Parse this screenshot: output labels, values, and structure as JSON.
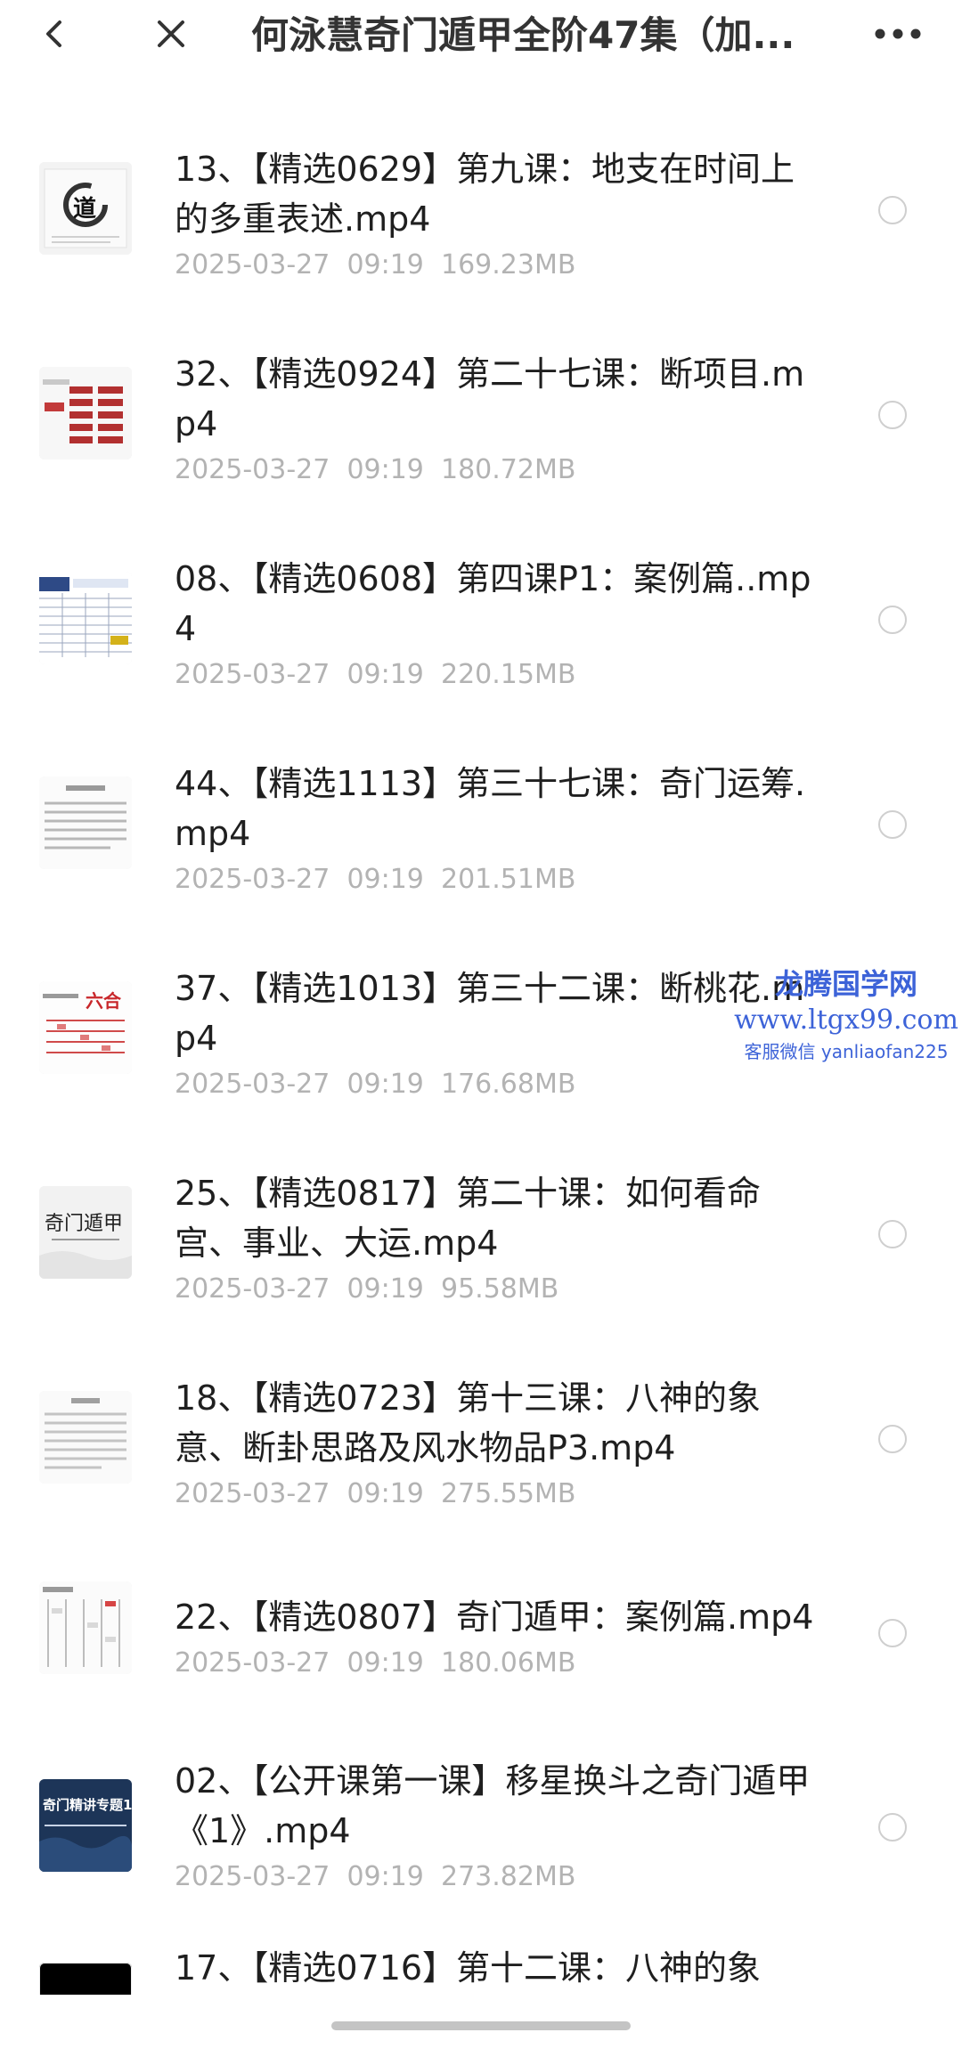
{
  "header": {
    "title": "何泳慧奇门遁甲全阶47集（加...",
    "back_icon": "chevron-left-icon",
    "close_icon": "close-icon",
    "more_icon": "more-horizontal-icon"
  },
  "files": [
    {
      "name": "13、【精选0629】第九课：地支在时间上的多重表述.mp4",
      "date": "2025-03-27",
      "time": "09:19",
      "size": "169.23MB",
      "thumb_text": "道",
      "thumb": "brush-circle"
    },
    {
      "name": "32、【精选0924】第二十七课：断项目.mp4",
      "date": "2025-03-27",
      "time": "09:19",
      "size": "180.72MB",
      "thumb": "table-red"
    },
    {
      "name": "08、【精选0608】第四课P1：案例篇..mp4",
      "date": "2025-03-27",
      "time": "09:19",
      "size": "220.15MB",
      "thumb": "table-blue"
    },
    {
      "name": "44、【精选1113】第三十七课：奇门运筹.mp4",
      "date": "2025-03-27",
      "time": "09:19",
      "size": "201.51MB",
      "thumb": "text-doc"
    },
    {
      "name": "37、【精选1013】第三十二课：断桃花.mp4",
      "date": "2025-03-27",
      "time": "09:19",
      "size": "176.68MB",
      "thumb_text": "六合",
      "thumb": "chart-red"
    },
    {
      "name": "25、【精选0817】第二十课：如何看命宫、事业、大运.mp4",
      "date": "2025-03-27",
      "time": "09:19",
      "size": "95.58MB",
      "thumb_text": "奇门遁甲",
      "thumb": "title-slide"
    },
    {
      "name": "18、【精选0723】第十三课：八神的象意、断卦思路及风水物品P3.mp4",
      "date": "2025-03-27",
      "time": "09:19",
      "size": "275.55MB",
      "thumb": "text-doc-2"
    },
    {
      "name": "22、【精选0807】奇门遁甲：案例篇.mp4",
      "date": "2025-03-27",
      "time": "09:19",
      "size": "180.06MB",
      "thumb": "grid-doc"
    },
    {
      "name": "02、【公开课第一课】移星换斗之奇门遁甲《1》.mp4",
      "date": "2025-03-27",
      "time": "09:19",
      "size": "273.82MB",
      "thumb_text": "奇门精讲专题1",
      "thumb": "dark-blue"
    },
    {
      "name": "17、【精选0716】第十二课：八神的象",
      "thumb": "black"
    }
  ],
  "watermark": {
    "title": "龙腾国学网",
    "url": "www.ltgx99.com",
    "contact": "客服微信 yanliaofan225"
  },
  "colors": {
    "text": "#1f1f1f",
    "meta": "#b3b3b3",
    "watermark": "#3d63d8",
    "radio_border": "#cfcfcf"
  }
}
